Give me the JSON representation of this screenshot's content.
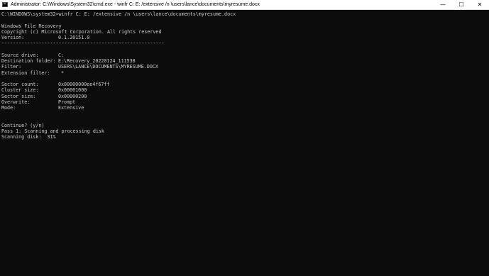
{
  "window": {
    "title": "Administrator: C:\\Windows\\System32\\cmd.exe - winfr  C: E: /extensive /n \\users\\lance\\documents\\myresume.docx",
    "icon": "cmd-icon",
    "minimize_glyph": "—",
    "maximize_glyph": "☐",
    "close_glyph": "✕"
  },
  "console": {
    "command_line": "C:\\WINDOWS\\system32>winfr C: E: /extensive /n \\users\\lance\\documents\\myresume.docx",
    "header": [
      "Windows File Recovery",
      "Copyright (c) Microsoft Corporation. All rights reserved"
    ],
    "version": {
      "label": "Version:",
      "value": "0.1.20151.0"
    },
    "separator": "---------------------------------------------------------",
    "info": [
      {
        "label": "Source drive:",
        "value": "C:"
      },
      {
        "label": "Destination folder:",
        "value": "E:\\Recovery_20220124_111538"
      },
      {
        "label": "Filter:",
        "value": "USERS\\LANCE\\DOCUMENTS\\MYRESUME.DOCX"
      },
      {
        "label": "Extension filter:",
        "value": "*"
      }
    ],
    "details": [
      {
        "label": "Sector count:",
        "value": "0x00000000ee4f67ff"
      },
      {
        "label": "Cluster size:",
        "value": "0x00001000"
      },
      {
        "label": "Sector size:",
        "value": "0x00000200"
      },
      {
        "label": "Overwrite:",
        "value": "Prompt"
      },
      {
        "label": "Mode:",
        "value": "Extensive"
      }
    ],
    "prompt": "Continue? (y/n)",
    "pass": "Pass 1: Scanning and processing disk",
    "progress": "Scanning disk:  31%"
  }
}
